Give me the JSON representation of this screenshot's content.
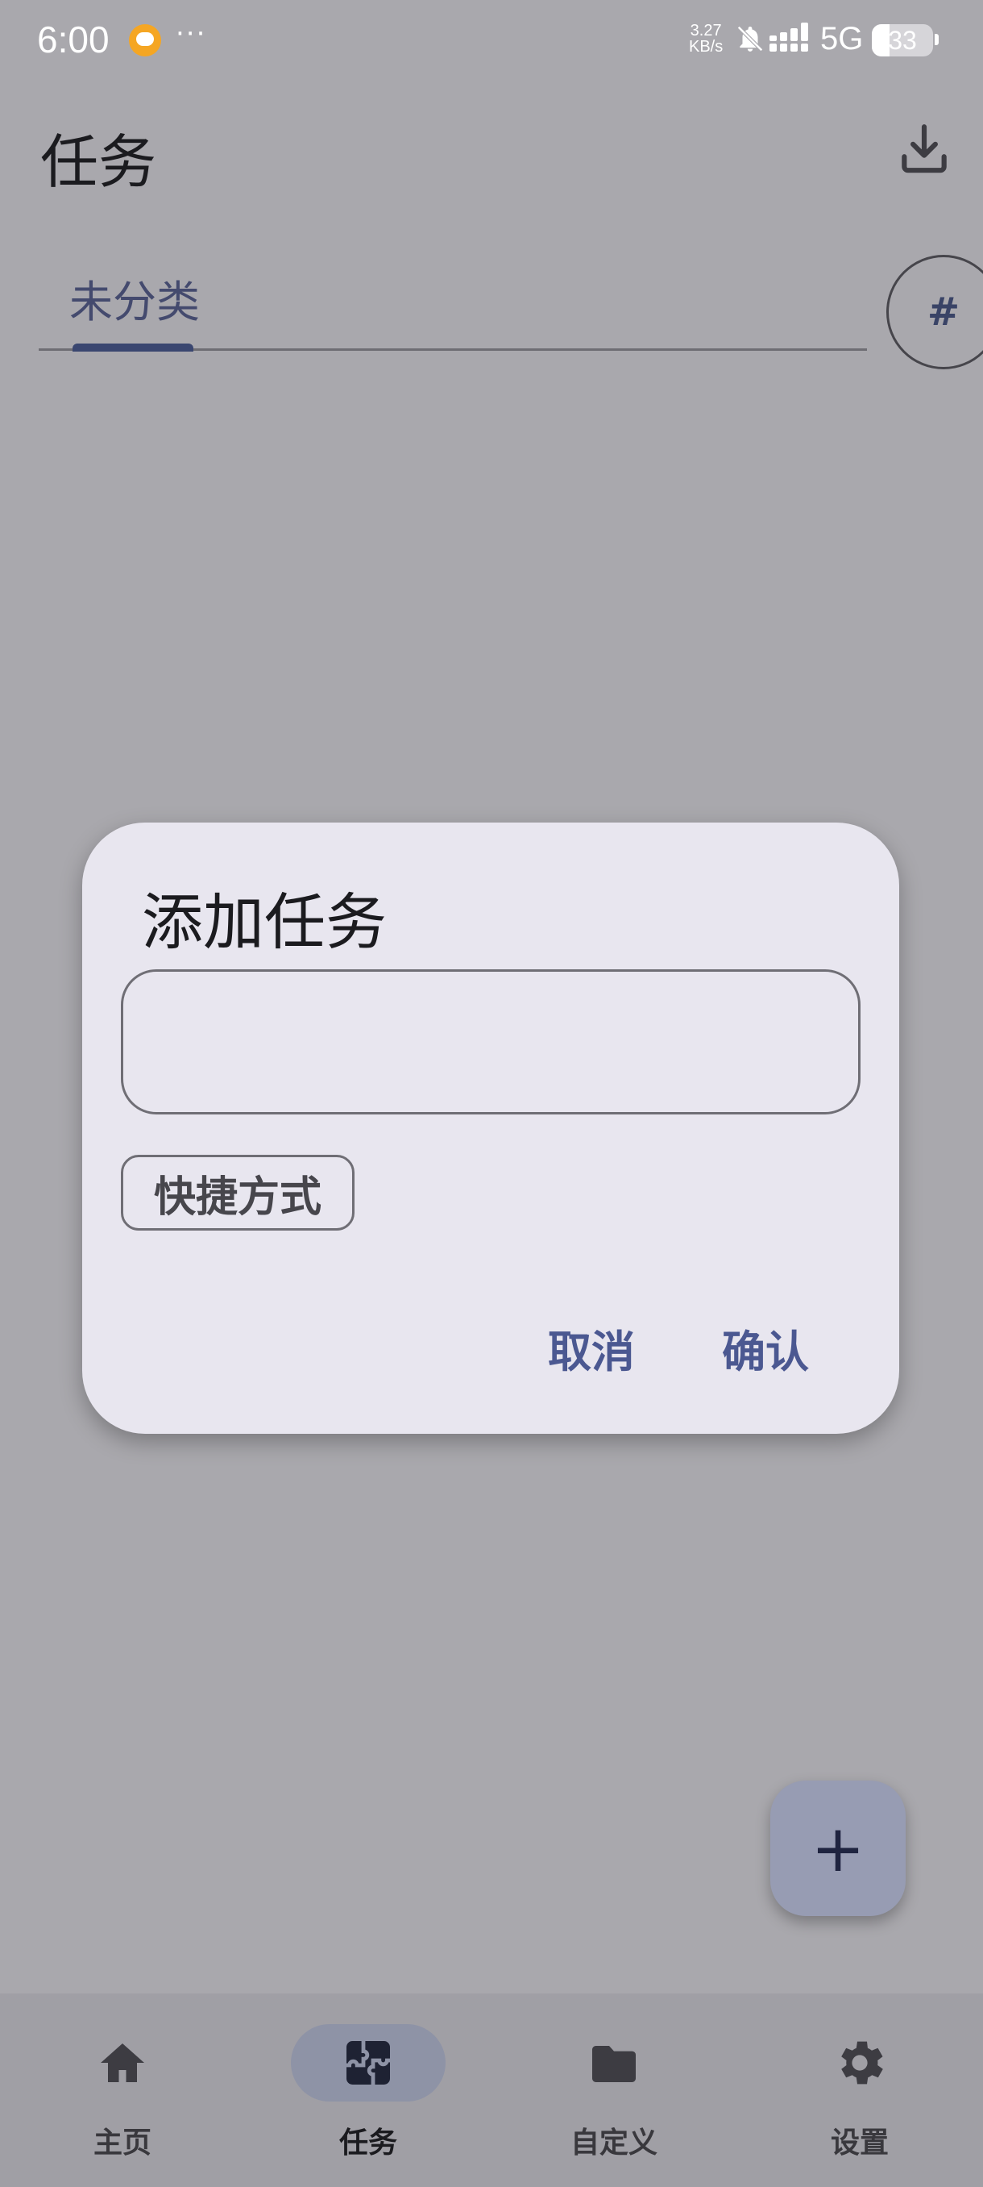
{
  "status_bar": {
    "time": "6:00",
    "dots": "···",
    "speed_value": "3.27",
    "speed_unit": "KB/s",
    "network": "5G",
    "battery": "33"
  },
  "header": {
    "title": "任务",
    "download_icon": "download-icon"
  },
  "tabs": {
    "items": [
      {
        "label": "未分类",
        "active": true
      }
    ],
    "hash_icon": "#"
  },
  "dialog": {
    "title": "添加任务",
    "input_value": "",
    "input_placeholder": "",
    "shortcut_label": "快捷方式",
    "cancel_label": "取消",
    "confirm_label": "确认"
  },
  "fab": {
    "icon": "+"
  },
  "bottom_nav": {
    "items": [
      {
        "label": "主页",
        "icon": "home-icon",
        "active": false
      },
      {
        "label": "任务",
        "icon": "tasks-icon",
        "active": true
      },
      {
        "label": "自定义",
        "icon": "folder-icon",
        "active": false
      },
      {
        "label": "设置",
        "icon": "gear-icon",
        "active": false
      }
    ]
  },
  "colors": {
    "scrim_background": "#a9a8ad",
    "dialog_surface": "#e8e6ef",
    "accent": "#4b5891",
    "tab_indicator": "#3a4670",
    "fab": "#979cb3"
  }
}
